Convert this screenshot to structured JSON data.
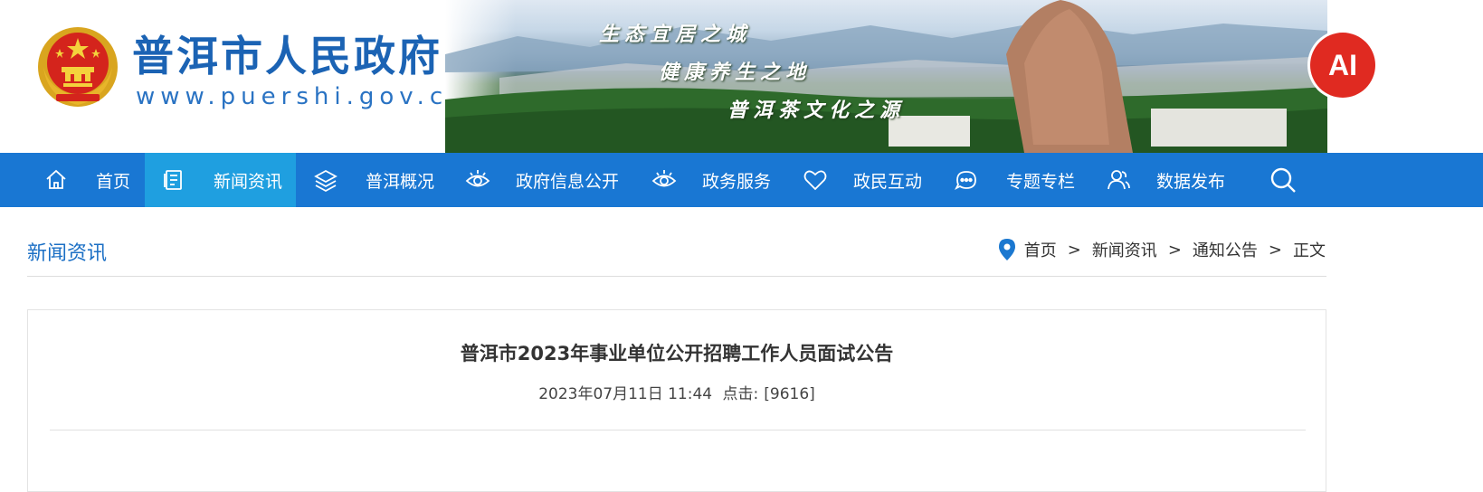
{
  "header": {
    "site_title": "普洱市人民政府",
    "site_url": "www.puershi.gov.cn",
    "slogans": [
      "生态宜居之城",
      "健康养生之地",
      "普洱茶文化之源"
    ],
    "ai_badge": "AI"
  },
  "nav": {
    "items": [
      {
        "label": "首页",
        "icon": "home-icon"
      },
      {
        "label": "新闻资讯",
        "icon": "news-icon",
        "active": true
      },
      {
        "label": "普洱概况",
        "icon": "layers-icon"
      },
      {
        "label": "政府信息公开",
        "icon": "eye-icon"
      },
      {
        "label": "政务服务",
        "icon": "eye-icon"
      },
      {
        "label": "政民互动",
        "icon": "heart-icon"
      },
      {
        "label": "专题专栏",
        "icon": "chat-icon"
      },
      {
        "label": "数据发布",
        "icon": "users-icon"
      }
    ],
    "search_icon": "search-icon"
  },
  "section": {
    "title": "新闻资讯"
  },
  "breadcrumb": {
    "items": [
      "首页",
      "新闻资讯",
      "通知公告",
      "正文"
    ],
    "separator": ">"
  },
  "article": {
    "title": "普洱市2023年事业单位公开招聘工作人员面试公告",
    "date": "2023年07月11日 11:44",
    "clicks_label": "点击:",
    "clicks_value": "[9616]"
  },
  "colors": {
    "nav_bg": "#1977d3",
    "nav_active": "#1f9fe0",
    "brand_blue": "#1b63b4",
    "ai_red": "#e02a21"
  }
}
